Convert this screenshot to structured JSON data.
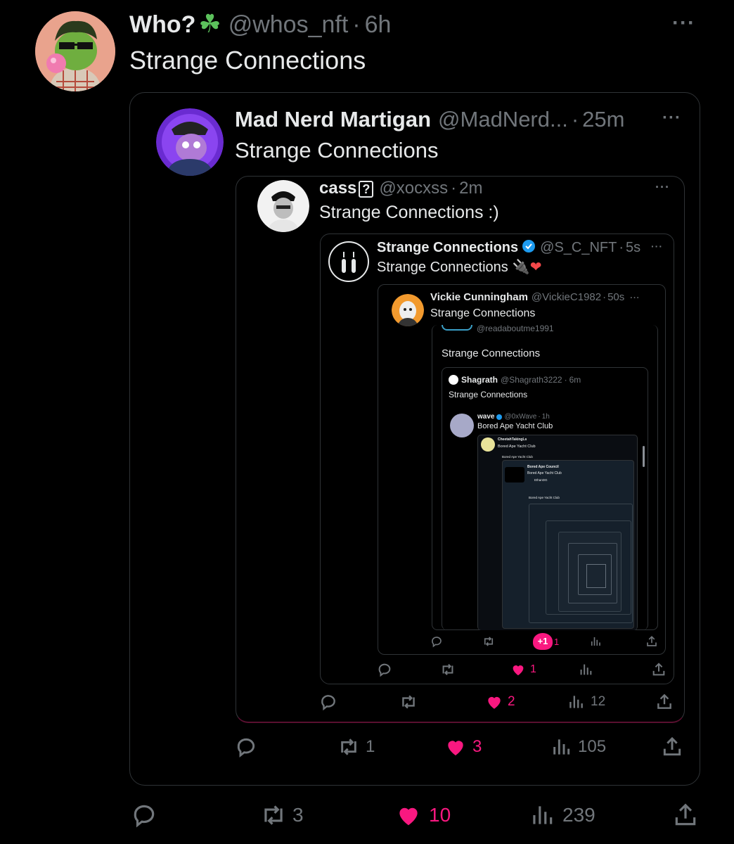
{
  "tweet": {
    "author_name": "Who?",
    "author_emoji": "☘",
    "handle": "@whos_nft",
    "dot": "·",
    "time": "6h",
    "text": "Strange Connections",
    "more": "···",
    "actions": {
      "replies": "",
      "retweets": "3",
      "likes": "10",
      "views": "239"
    }
  },
  "quote1": {
    "author_name": "Mad Nerd Martigan",
    "handle": "@MadNerd...",
    "dot": "·",
    "time": "25m",
    "text": "Strange Connections",
    "more": "···",
    "actions": {
      "replies": "",
      "retweets": "1",
      "likes": "3",
      "views": "105"
    }
  },
  "quote2": {
    "author_name": "cass",
    "badge": "?",
    "handle": "@xocxss",
    "dot": "·",
    "time": "2m",
    "text": "Strange Connections :)",
    "more": "···",
    "actions": {
      "replies": "",
      "retweets": "",
      "likes": "2",
      "views": "12"
    }
  },
  "quote3": {
    "author_name": "Strange Connections",
    "handle": "@S_C_NFT",
    "dot": "·",
    "time": "5s",
    "text": "Strange Connections",
    "emoji": "🔌❤",
    "more": "···",
    "actions": {
      "replies": "",
      "retweets": "",
      "likes": "1",
      "views": ""
    }
  },
  "quote4": {
    "author_name": "Vickie Cunningham",
    "handle": "@VickieC1982",
    "dot": "·",
    "time": "50s",
    "text": "Strange Connections",
    "more": "···",
    "sub_handle": "@readaboutme1991",
    "sub_text": "Strange Connections",
    "like_badge": "+1",
    "actions": {
      "replies": "",
      "retweets": "",
      "likes": "1",
      "views": ""
    }
  },
  "quote5": {
    "author_name": "Shagrath",
    "handle": "@Shagrath3222",
    "dot": "·",
    "time": "6m",
    "text": "Strange Connections"
  },
  "quote6": {
    "author_name": "wave",
    "handle": "@0xWave",
    "dot": "·",
    "time": "1h",
    "text": "Bored Ape Yacht Club"
  },
  "quote7": {
    "author_name": "CheetahTakingLs",
    "text": "Bored Ape Yacht Club",
    "sub_text": "Bored Ape Yacht Club"
  },
  "quote8": {
    "author_name": "Bored Ape Council",
    "text": "Bored Ape Yacht Club",
    "sub_author": "EthanDG",
    "sub_text": "Bored Ape Yacht Club"
  },
  "colors": {
    "bg": "#000000",
    "text": "#e7e9ea",
    "muted": "#71767b",
    "like": "#f91880",
    "verified": "#1d9bf0",
    "border": "#2f3336"
  }
}
